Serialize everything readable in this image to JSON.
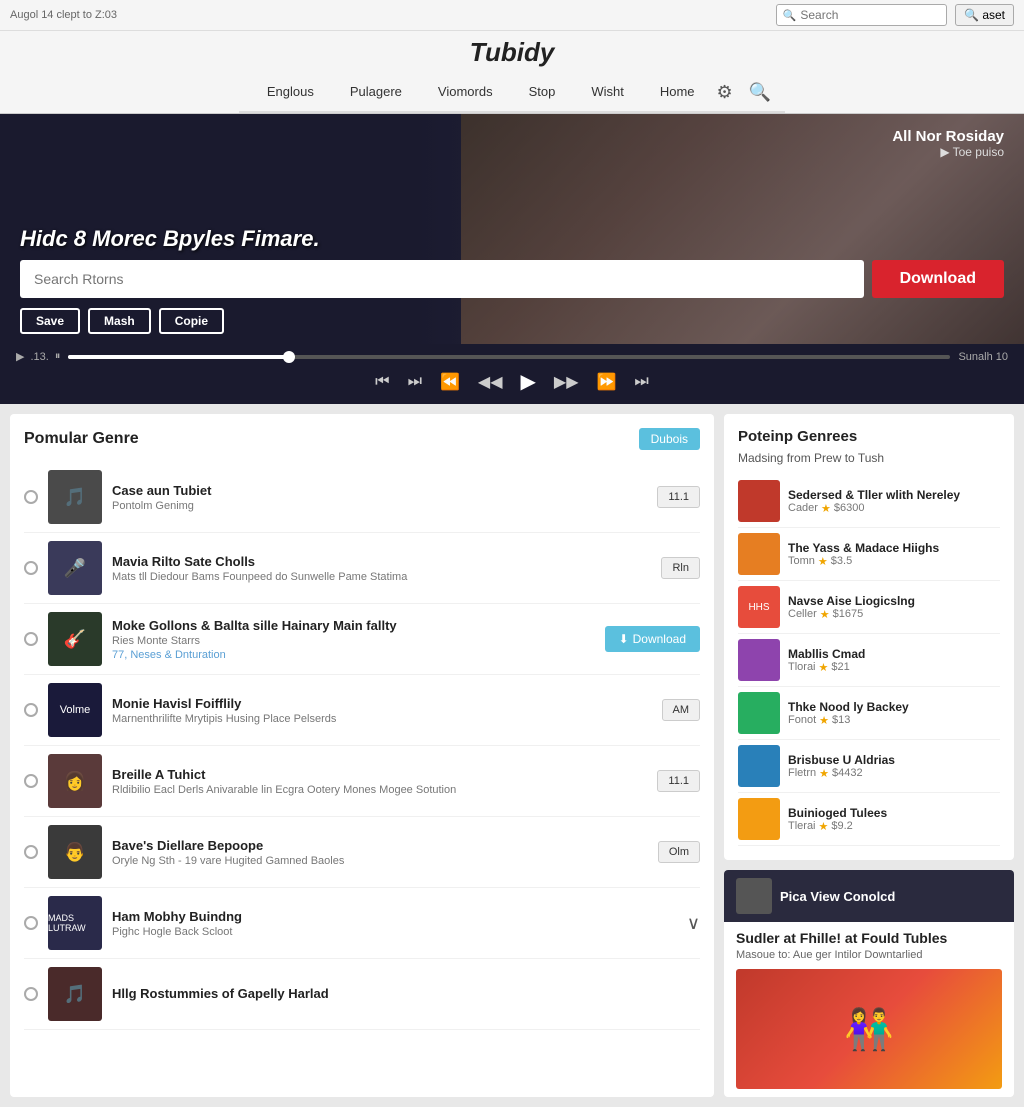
{
  "header": {
    "datetime": "Augol 14 clept to Z:03",
    "logo": "Tubidy",
    "search_placeholder": "Search",
    "aset_label": "aset"
  },
  "nav": {
    "items": [
      {
        "label": "Englous"
      },
      {
        "label": "Pulagere"
      },
      {
        "label": "Viomords"
      },
      {
        "label": "Stop"
      },
      {
        "label": "Wisht"
      },
      {
        "label": "Home"
      }
    ]
  },
  "hero": {
    "title": "Hidc 8 Morec Bpyles Fimare.",
    "all_nor_label": "All Nor Rosiday",
    "toe_puiso": "Toe puiso",
    "search_placeholder": "Search Rtorns",
    "download_btn": "Download",
    "save_btn": "Save",
    "mash_btn": "Mash",
    "copie_btn": "Copie",
    "duration": "Sunalh 10",
    "progress_info": ".13."
  },
  "popular_genre": {
    "title": "Pomular Genre",
    "dubois_btn": "Dubois",
    "tracks": [
      {
        "title": "Case aun Tubiet",
        "sub": "Pontolm Genimg",
        "action": "11.1",
        "color": "#4a4a4a"
      },
      {
        "title": "Mavia Rilto Sate Cholls",
        "sub": "Mats tll Diedour Bams Founpeed do Sunwelle Pame Statima",
        "action": "Rln",
        "color": "#3a3a5a"
      },
      {
        "title": "Moke Gollons & Ballta sille Hainary Main fallty",
        "sub": "Ries Monte Starrs",
        "tags": "77, Neses & Dnturation",
        "action": "Download",
        "action_type": "download",
        "color": "#2a3a2a"
      },
      {
        "title": "Monie Havisl Foifflily",
        "sub": "Marnenthrilifte Mrytipis Husing Place Pelserds",
        "action": "AM",
        "color": "#1a1a3a"
      },
      {
        "title": "Breille A Tuhict",
        "sub": "Rldibilio Eacl Derls Anivarable lin Ecgra Ootery Mones Mogee Sotution",
        "action": "11.1",
        "color": "#5a3a3a"
      },
      {
        "title": "Bave's Diellare Bepoope",
        "sub": "Oryle Ng Sth - 19 vare Hugited Gamned Baoles",
        "action": "Olm",
        "color": "#3a3a3a"
      },
      {
        "title": "Ham Mobhy Buindng",
        "sub": "Pighc Hogle Back Scloot",
        "action": "chevron",
        "color": "#2a2a4a"
      },
      {
        "title": "Hllg Rostummies of Gapelly Harlad",
        "sub": "",
        "action": "",
        "color": "#4a2a2a"
      }
    ]
  },
  "trending": {
    "title": "Poteinp Genrees",
    "subtitle": "Madsing from Prew to Tush",
    "items": [
      {
        "title": "Sedersed & Tller wlith Nereley",
        "meta": "Cader",
        "stars": "$6300",
        "color": "#c0392b"
      },
      {
        "title": "The Yass & Madace Hiighs",
        "meta": "Tomn",
        "stars": "$3.5",
        "color": "#e67e22"
      },
      {
        "title": "Navse Aise Liogicslng",
        "meta": "Celler",
        "stars": "$1675",
        "color": "#e74c3c"
      },
      {
        "title": "Mabllis Cmad",
        "meta": "Tlorai",
        "stars": "$21",
        "color": "#8e44ad"
      },
      {
        "title": "Thke Nood ly Backey",
        "meta": "Fonot",
        "stars": "$13",
        "color": "#27ae60"
      },
      {
        "title": "Brisbuse U Aldrias",
        "meta": "Fletrn",
        "stars": "$4432",
        "color": "#2980b9"
      },
      {
        "title": "Buinioged Tulees",
        "meta": "Tlerai",
        "stars": "$9.2",
        "color": "#f39c12"
      }
    ]
  },
  "promo": {
    "header_label": "Pica View Conolcd",
    "main_title": "Sudler at Fhille! at Fould Tubles",
    "desc": "Masoue to: Aue ger Intilor Downtarlied"
  }
}
